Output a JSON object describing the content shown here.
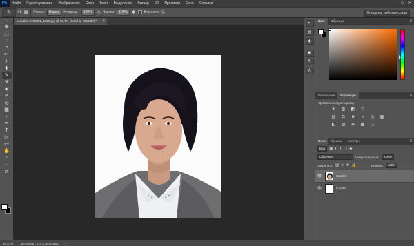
{
  "app": {
    "logo": "Ps"
  },
  "menu": [
    "Файл",
    "Редактирование",
    "Изображение",
    "Слои",
    "Текст",
    "Выделение",
    "Фильтр",
    "3D",
    "Просмотр",
    "Окно",
    "Справка"
  ],
  "window_controls": {
    "minimize": "—",
    "maximize": "□",
    "close": "✕"
  },
  "options": {
    "brush_size": "65",
    "mode_label": "Режим:",
    "mode_value": "Норма",
    "opacity_label": "Непрозр.:",
    "opacity_value": "100%",
    "flow_label": "Нажим:",
    "flow_value": "100%",
    "sample_all_label": "Все слои",
    "workspace": "Основная рабочая среда"
  },
  "document_tab": {
    "title": "beautiful-2158081_1920.jpg @ 66,7% (Слой 1, RGB/8#) *",
    "close": "×"
  },
  "tools": [
    "✥",
    "⬚",
    "◌",
    "⌗",
    "✂",
    "⊹",
    "✚",
    "✎",
    "⚒",
    "◈",
    "✐",
    "◎",
    "▦",
    "◐",
    "✒",
    "T",
    "▷",
    "▭",
    "✋",
    "⌕",
    "⋯",
    "⇄"
  ],
  "status": {
    "zoom": "66,67%",
    "doc_info": "Экспонир.: 1 × 1,3006 пикс",
    "arrow": "▸"
  },
  "dock_icons": [
    "⬌",
    "▤",
    "◆",
    "▣",
    "¶",
    "A"
  ],
  "color_panel": {
    "tabs": [
      "Цвет",
      "Образцы"
    ],
    "menu": "≡",
    "foreground": "#ffffff",
    "background": "#000000",
    "hue_color": "#ff6a00"
  },
  "adjust_panel": {
    "tabs": [
      "Библиотеки",
      "Коррекция"
    ],
    "active_tab": "Коррекция",
    "title": "Добавить корректировку",
    "row1": [
      "☀",
      "▥",
      "◩",
      "▽"
    ],
    "row2": [
      "▤",
      "⚖",
      "■",
      "◑",
      "◎",
      "▦"
    ],
    "row3": [
      "◧",
      "▨",
      "◈",
      "▩",
      "▢"
    ]
  },
  "layers_panel": {
    "tabs": [
      "Слои",
      "Каналы",
      "Контуры"
    ],
    "kind_label": "Вид",
    "filter_icons": [
      "▣",
      "◐",
      "T",
      "▢",
      "◆"
    ],
    "blend_mode": "Обычные",
    "opacity_label": "Непрозрачность:",
    "opacity_value": "100%",
    "lock_label": "Закрепить:",
    "lock_icons": [
      "▨",
      "✎",
      "✥",
      "🔒"
    ],
    "fill_label": "Заливка:",
    "fill_value": "100%",
    "layers": [
      {
        "name": "Слой 1",
        "visible": "👁",
        "selected": true
      },
      {
        "name": "Слой 0",
        "visible": "👁",
        "selected": false
      }
    ],
    "bottom_icons": [
      "⛓",
      "fx",
      "◑",
      "▦",
      "▭",
      "🗑"
    ]
  }
}
